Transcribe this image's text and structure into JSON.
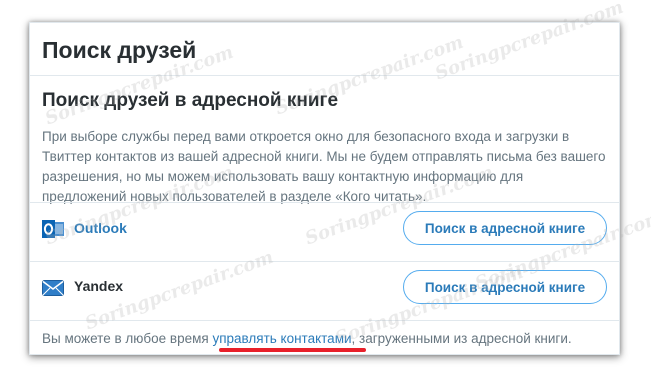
{
  "dialog": {
    "title": "Поиск друзей",
    "subtitle": "Поиск друзей в адресной книге",
    "description": "При выборе службы перед вами откроется окно для безопасного входа и загрузки в Твиттер контактов из вашей адресной книги. Мы не будем отправлять письма без вашего разрешения, но мы можем использовать вашу контактную информацию для предложений новых пользователей в разделе «Кого читать»."
  },
  "services": [
    {
      "name": "Outlook",
      "button_label": "Поиск в адресной книге",
      "icon": "outlook-icon"
    },
    {
      "name": "Yandex",
      "button_label": "Поиск в адресной книге",
      "icon": "mail-envelope-icon"
    }
  ],
  "footer": {
    "text_before": "Вы можете в любое время ",
    "link_text": "управлять контактами",
    "text_after": ", загруженными из адресной книги."
  },
  "watermark": {
    "text": "Soringpcrepair.com"
  },
  "colors": {
    "accent": "#2b7bb9",
    "button_border": "#55acee",
    "highlight_underline": "#e8202a",
    "text_primary": "#292f33",
    "text_secondary": "#66757f"
  }
}
